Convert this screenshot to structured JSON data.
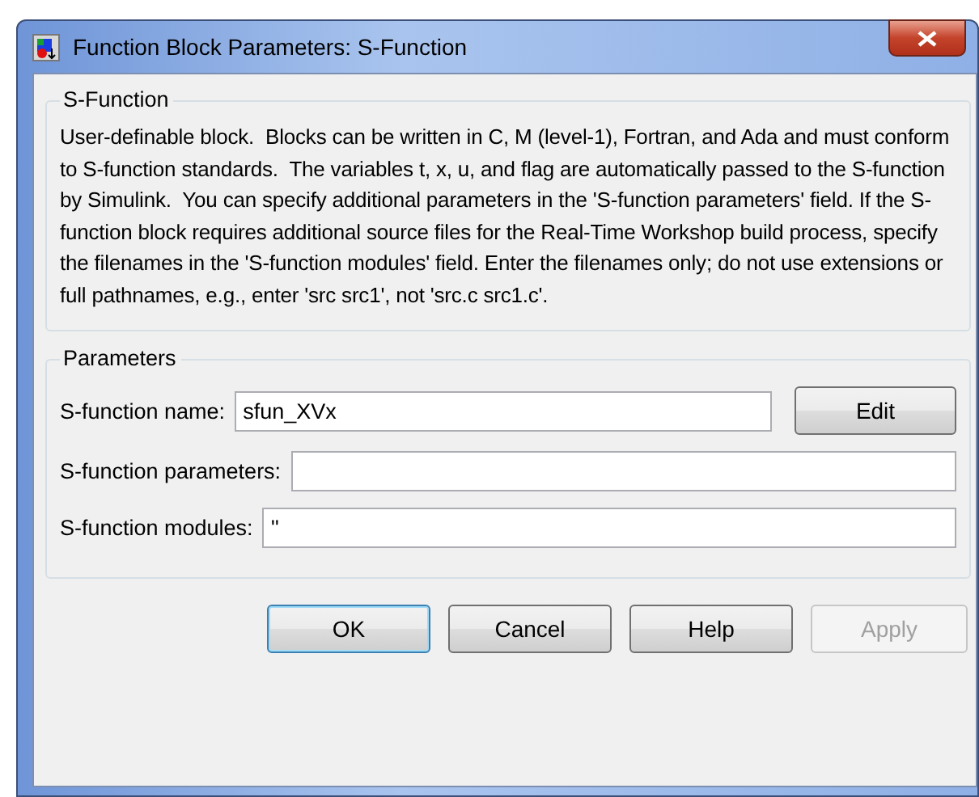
{
  "window": {
    "title": "Function Block Parameters: S-Function"
  },
  "description_group": {
    "title": "S-Function",
    "text": "User-definable block.  Blocks can be written in C, M (level-1), Fortran, and Ada and must conform to S-function standards.  The variables t, x, u, and flag are automatically passed to the S-function by Simulink.  You can specify additional parameters in the 'S-function parameters' field. If the S-function block requires additional source files for the Real-Time Workshop build process, specify the filenames in the 'S-function modules' field. Enter the filenames only; do not use extensions or full pathnames, e.g., enter 'src src1', not 'src.c src1.c'."
  },
  "parameters_group": {
    "title": "Parameters",
    "fields": [
      {
        "label": "S-function name:",
        "value": "sfun_XVx",
        "button": "Edit"
      },
      {
        "label": "S-function parameters:"
      },
      {
        "label": "S-function modules:",
        "value": "''"
      }
    ]
  },
  "buttons": [
    {
      "label": "OK",
      "default": true,
      "disabled": false
    },
    {
      "label": "Cancel",
      "default": false,
      "disabled": false
    },
    {
      "label": "Help",
      "default": false,
      "disabled": false
    },
    {
      "label": "Apply",
      "default": false,
      "disabled": true
    }
  ]
}
